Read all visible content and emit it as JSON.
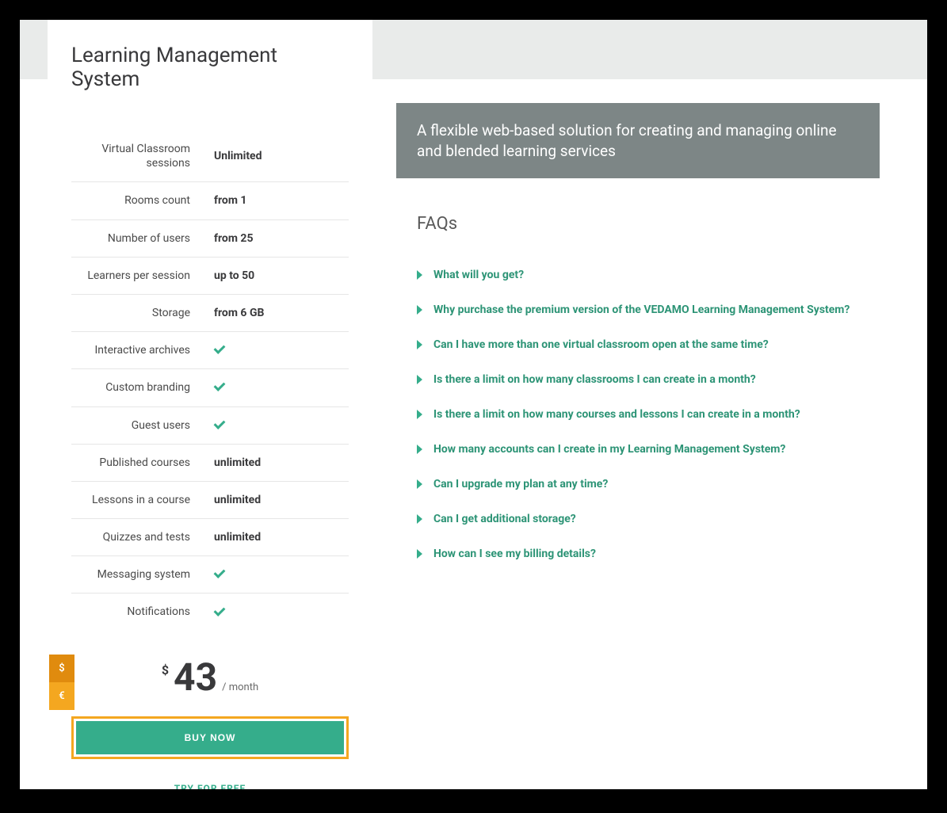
{
  "page_title": "Learning Management System",
  "features": [
    {
      "label": "Virtual Classroom sessions",
      "value": "Unlimited",
      "check": false
    },
    {
      "label": "Rooms count",
      "value": "from 1",
      "check": false
    },
    {
      "label": "Number of users",
      "value": "from 25",
      "check": false
    },
    {
      "label": "Learners per session",
      "value": "up to 50",
      "check": false
    },
    {
      "label": "Storage",
      "value": "from 6 GB",
      "check": false
    },
    {
      "label": "Interactive archives",
      "value": "",
      "check": true
    },
    {
      "label": "Custom branding",
      "value": "",
      "check": true
    },
    {
      "label": "Guest users",
      "value": "",
      "check": true
    },
    {
      "label": "Published courses",
      "value": "unlimited",
      "check": false
    },
    {
      "label": "Lessons in a course",
      "value": "unlimited",
      "check": false
    },
    {
      "label": "Quizzes and tests",
      "value": "unlimited",
      "check": false
    },
    {
      "label": "Messaging system",
      "value": "",
      "check": true
    },
    {
      "label": "Notifications",
      "value": "",
      "check": true
    }
  ],
  "pricing": {
    "currency_dollar": "$",
    "currency_euro": "€",
    "currency_symbol": "$",
    "amount": "43",
    "period": "/ month",
    "buy_label": "BUY NOW",
    "try_label": "TRY FOR FREE"
  },
  "description": "A flexible web-based solution for creating and managing online and blended learning services",
  "faq_title": "FAQs",
  "faqs": [
    "What will you get?",
    "Why purchase the premium version of the VEDAMO Learning Management System?",
    "Can I have more than one virtual classroom open at the same time?",
    "Is there a limit on how many classrooms I can create in a month?",
    "Is there a limit on how many courses and lessons I can create in a month?",
    "How many accounts can I create in my Learning Management System?",
    "Can I upgrade my plan at any time?",
    "Can I get additional storage?",
    "How can I see my billing details?"
  ]
}
